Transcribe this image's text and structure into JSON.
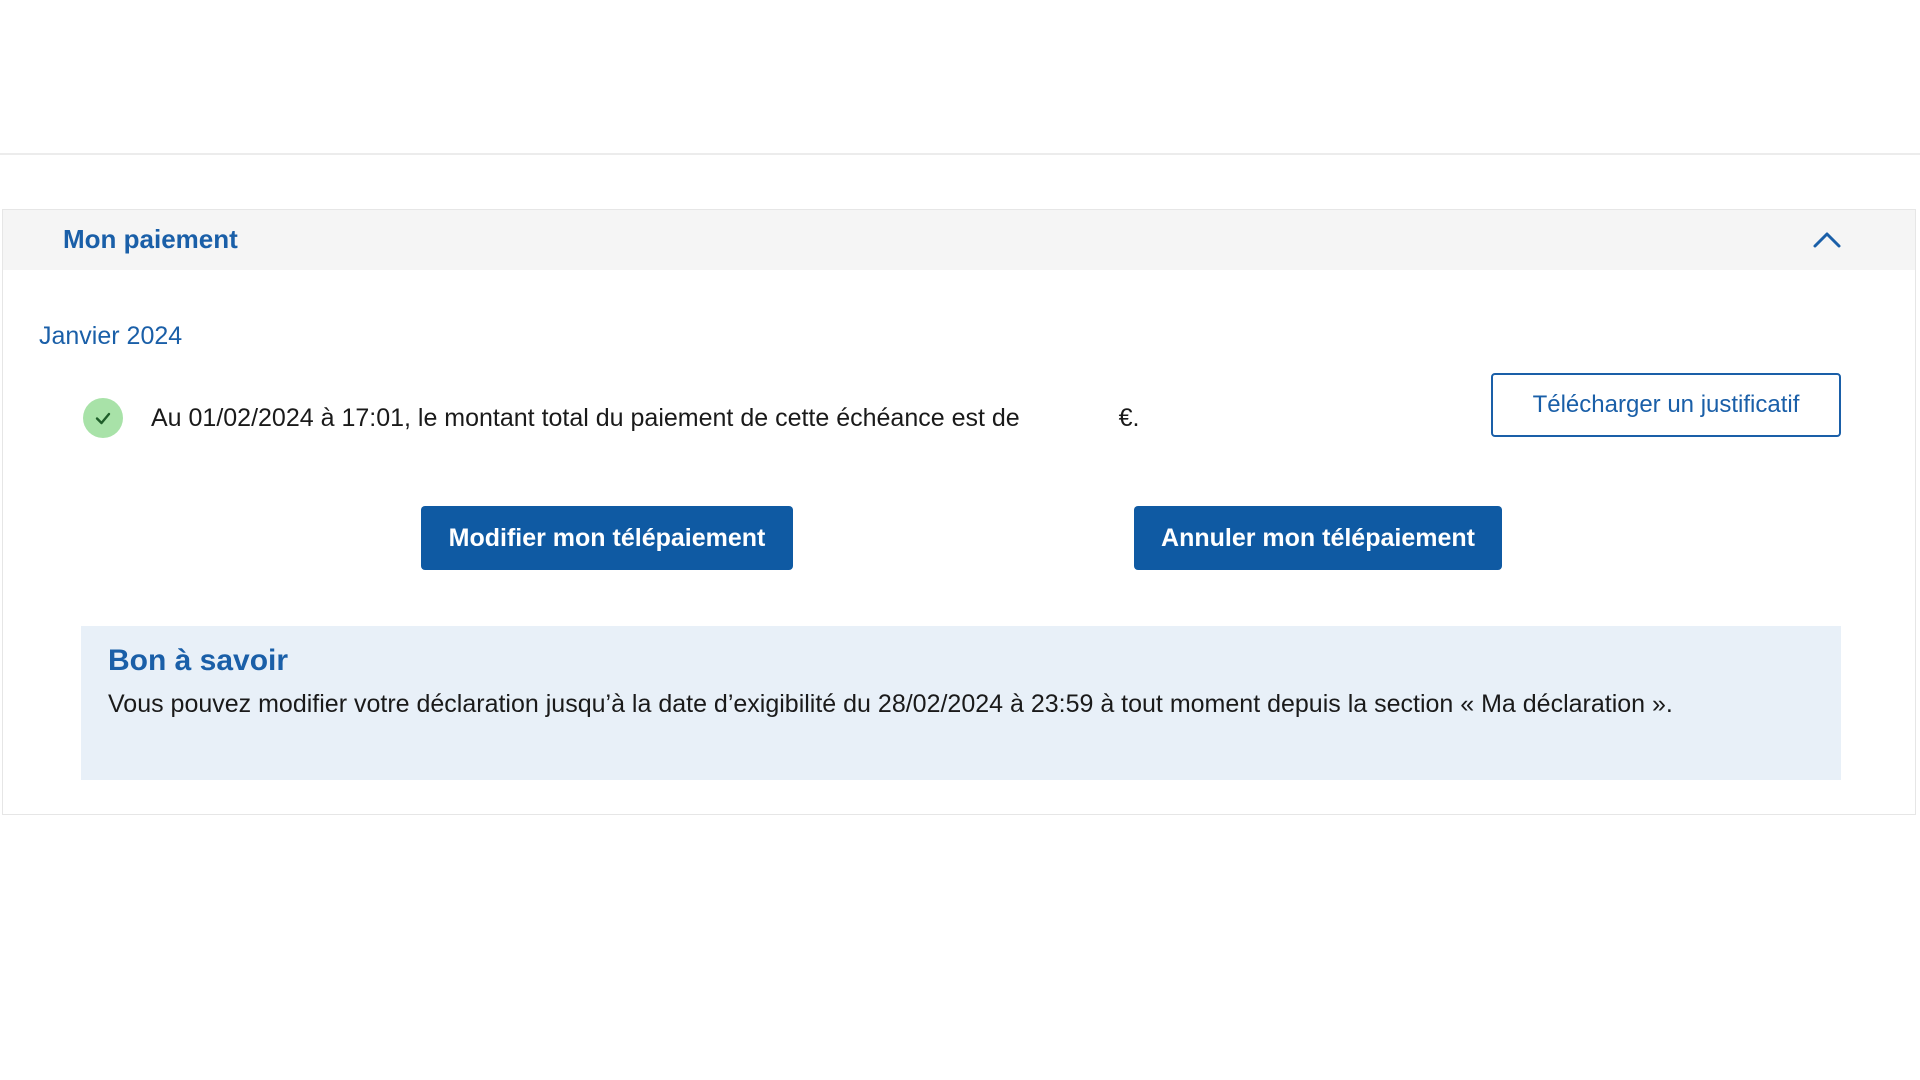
{
  "panel": {
    "title": "Mon paiement",
    "expanded": true,
    "toggle_icon": "chevron-up-icon"
  },
  "period": {
    "label": "Janvier 2024"
  },
  "status": {
    "icon": "check-icon",
    "text_before": "Au 01/02/2024 à 17:01, le montant total du paiement de cette échéance est de",
    "amount": "",
    "currency_suffix": "€."
  },
  "actions": {
    "download_label": "Télécharger un justificatif",
    "modify_label": "Modifier mon télépaiement",
    "cancel_label": "Annuler mon télépaiement"
  },
  "info": {
    "title": "Bon à savoir",
    "text": "Vous pouvez modifier votre déclaration jusqu’à la date d’exigibilité du 28/02/2024 à 23:59 à tout moment depuis la section « Ma déclaration »."
  },
  "colors": {
    "accent": "#1a5fa8",
    "primary_button": "#0f5aa3",
    "header_bg": "#f5f5f5",
    "info_bg": "#e8f0f8",
    "success": "#a8e2a8"
  }
}
